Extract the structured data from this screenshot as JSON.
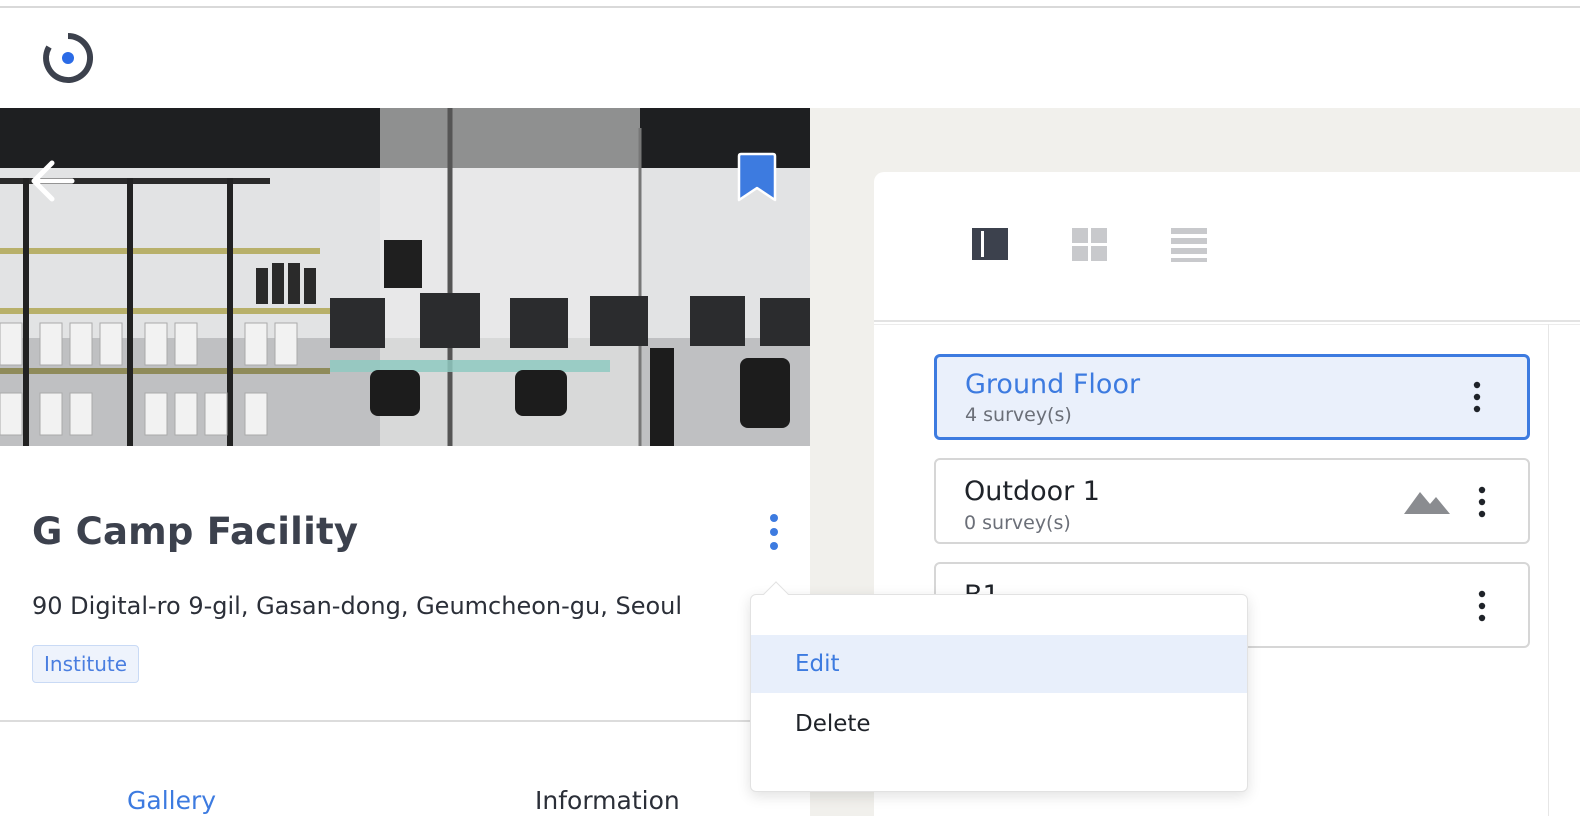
{
  "facility": {
    "name": "G Camp Facility",
    "address": "90 Digital-ro 9-gil, Gasan-dong, Geumcheon-gu, Seoul",
    "tag": "Institute"
  },
  "tabs": [
    {
      "label": "Gallery",
      "active": true
    },
    {
      "label": "Information",
      "active": false
    }
  ],
  "view_modes": [
    "split-view-icon",
    "grid-view-icon",
    "list-view-icon"
  ],
  "floors": [
    {
      "name": "Ground Floor",
      "surveys": "4 survey(s)",
      "selected": true
    },
    {
      "name": "Outdoor 1",
      "surveys": "0 survey(s)",
      "selected": false
    },
    {
      "name": "B1",
      "surveys": "",
      "selected": false
    }
  ],
  "context_menu": {
    "items": [
      "Edit",
      "Delete"
    ]
  },
  "colors": {
    "accent": "#3d7be0",
    "selected_bg": "#eaf0fb",
    "right_bg": "#f1f0ec"
  }
}
